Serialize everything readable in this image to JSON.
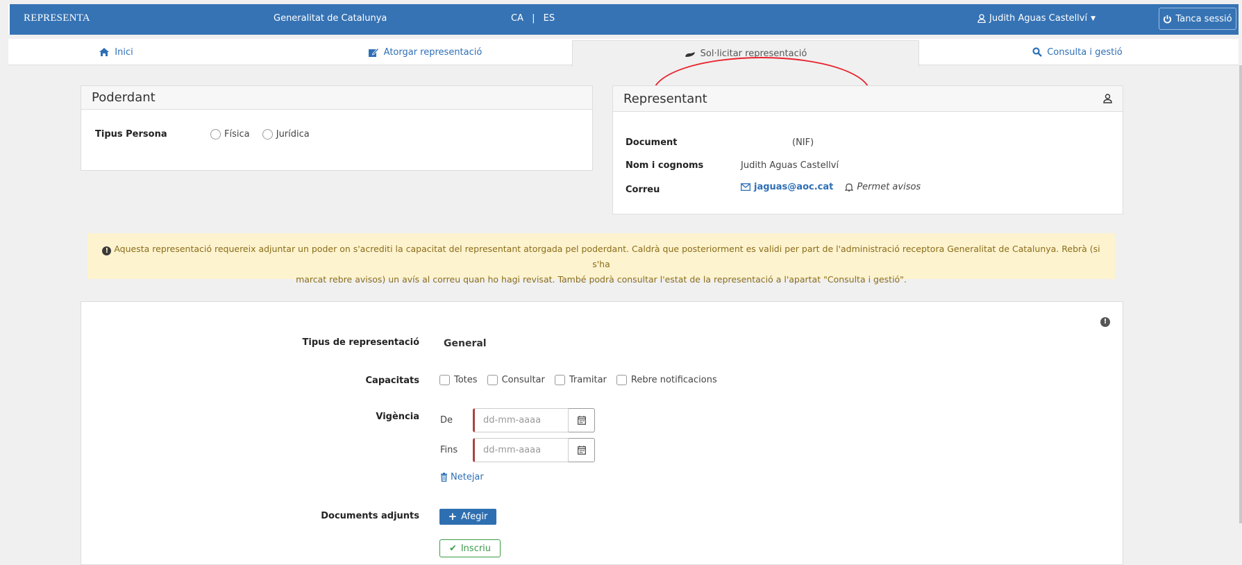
{
  "header": {
    "brand": "REPRESENTA",
    "org": "Generalitat de Catalunya",
    "lang_ca": "CA",
    "lang_sep": "|",
    "lang_es": "ES",
    "user_name": "Judith Aguas Castellví",
    "logout": "Tanca sessió"
  },
  "tabs": [
    {
      "label": "Inici",
      "icon": "home-icon"
    },
    {
      "label": "Atorgar representació",
      "icon": "sign-icon"
    },
    {
      "label": "Sol·licitar representació",
      "icon": "hand-icon",
      "active": true
    },
    {
      "label": "Consulta i gestió",
      "icon": "search-icon"
    }
  ],
  "poderdant": {
    "title": "Poderdant",
    "tipus_label": "Tipus Persona",
    "opt_fisica": "Física",
    "opt_juridica": "Jurídica"
  },
  "representant": {
    "title": "Representant",
    "document_label": "Document",
    "document_value": "(NIF)",
    "nom_label": "Nom i cognoms",
    "nom_value": "Judith Aguas Castellví",
    "correu_label": "Correu",
    "correu_value": "jaguas@aoc.cat",
    "avisos": "Permet avisos"
  },
  "alert": {
    "line1": "Aquesta representació requereix adjuntar un poder on s'acrediti la capacitat del representant atorgada pel poderdant. Caldrà que posteriorment es validi per part de l'administració receptora Generalitat de Catalunya. Rebrà (si s'ha",
    "line2": "marcat rebre avisos) un avís al correu quan ho hagi revisat. També podrà consultar l'estat de la representació a l'apartat \"Consulta i gestió\"."
  },
  "form": {
    "tipus_label": "Tipus de representació",
    "tipus_value": "General",
    "capacitats_label": "Capacitats",
    "cap_totes": "Totes",
    "cap_consultar": "Consultar",
    "cap_tramitar": "Tramitar",
    "cap_rebre": "Rebre notificacions",
    "vigencia_label": "Vigència",
    "de_label": "De",
    "fins_label": "Fins",
    "date_placeholder": "dd-mm-aaaa",
    "netejar": "Netejar",
    "documents_label": "Documents adjunts",
    "afegir": "Afegir",
    "green_btn": "Inscriu"
  },
  "colors": {
    "topbar": "#3673b4",
    "link": "#2d6fb6",
    "alert_bg": "#fdf3cf",
    "highlight": "#e8202a"
  }
}
